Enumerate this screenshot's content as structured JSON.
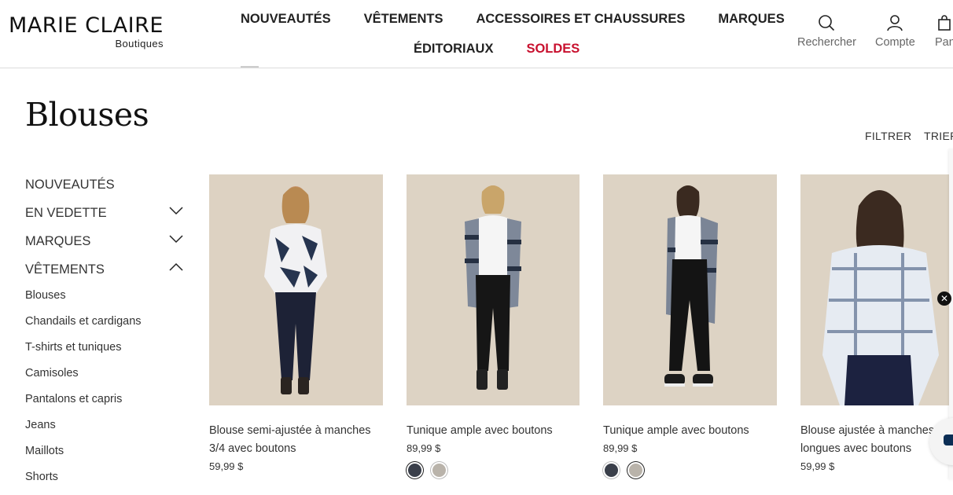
{
  "brand": {
    "name": "MARIE CLAIRE",
    "sub": "Boutiques"
  },
  "nav": {
    "row1": [
      "NOUVEAUTÉS",
      "VÊTEMENTS",
      "ACCESSOIRES ET CHAUSSURES",
      "MARQUES"
    ],
    "row2": [
      "ÉDITORIAUX",
      "SOLDES"
    ]
  },
  "tools": {
    "search": "Rechercher",
    "account": "Compte",
    "cart": "Panier"
  },
  "page": {
    "title": "Blouses",
    "filter": "FILTRER",
    "sort": "TRIER"
  },
  "sidebar": {
    "categories": [
      {
        "label": "NOUVEAUTÉS",
        "state": "none"
      },
      {
        "label": "EN VEDETTE",
        "state": "collapsed"
      },
      {
        "label": "MARQUES",
        "state": "collapsed"
      },
      {
        "label": "VÊTEMENTS",
        "state": "expanded"
      }
    ],
    "subitems": [
      "Blouses",
      "Chandails et cardigans",
      "T-shirts et tuniques",
      "Camisoles",
      "Pantalons et capris",
      "Jeans",
      "Maillots",
      "Shorts"
    ]
  },
  "products": [
    {
      "name": "Blouse semi-ajustée à manches 3/4 avec boutons",
      "price": "59,99 $",
      "swatches": []
    },
    {
      "name": "Tunique ample avec boutons",
      "price": "89,99 $",
      "swatches": [
        "#3a3f4a",
        "#b9b3aa"
      ]
    },
    {
      "name": "Tunique ample avec boutons",
      "price": "89,99 $",
      "swatches": [
        "#3a3f4a",
        "#b9b3aa"
      ]
    },
    {
      "name": "Blouse ajustée à manches longues avec boutons",
      "price": "59,99 $",
      "swatches": []
    }
  ],
  "colors": {
    "sale": "#c8102e",
    "photo_bg": "#ddd3c4"
  }
}
